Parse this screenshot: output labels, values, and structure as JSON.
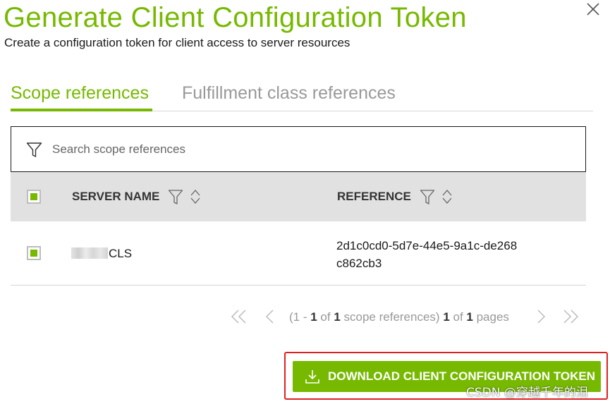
{
  "dialog": {
    "title": "Generate Client Configuration Token",
    "subtitle": "Create a configuration token for client access to server resources",
    "close_icon": "close-icon"
  },
  "tabs": [
    {
      "label": "Scope references",
      "active": true
    },
    {
      "label": "Fulfillment class references",
      "active": false
    }
  ],
  "search": {
    "placeholder": "Search scope references",
    "value": "",
    "icon": "filter-icon"
  },
  "table": {
    "columns": [
      {
        "label": "SERVER NAME",
        "icons": [
          "filter-icon",
          "sort-icon"
        ]
      },
      {
        "label": "REFERENCE",
        "icons": [
          "filter-icon",
          "sort-icon"
        ]
      }
    ],
    "select_all_checked": true,
    "rows": [
      {
        "checked": true,
        "server_name_visible": "CLS",
        "reference": "2d1c0cd0-5d7e-44e5-9a1c-de268c862cb3"
      }
    ]
  },
  "pagination": {
    "range_prefix": "(1 - ",
    "range_end": "1",
    "of_word": " of ",
    "total_items": "1",
    "items_suffix": " scope references) ",
    "current_page": "1",
    "of_word2": " of ",
    "total_pages": "1",
    "pages_suffix": " pages",
    "icons": [
      "first-page-icon",
      "prev-page-icon",
      "next-page-icon",
      "last-page-icon"
    ]
  },
  "actions": {
    "download_label": "DOWNLOAD CLIENT CONFIGURATION TOKEN",
    "download_icon": "download-icon"
  },
  "watermark": "CSDN @穿越千年的泪",
  "colors": {
    "accent": "#76b900",
    "header_bg": "#e1e1e1",
    "highlight_border": "#e02020",
    "muted_text": "#999999"
  }
}
